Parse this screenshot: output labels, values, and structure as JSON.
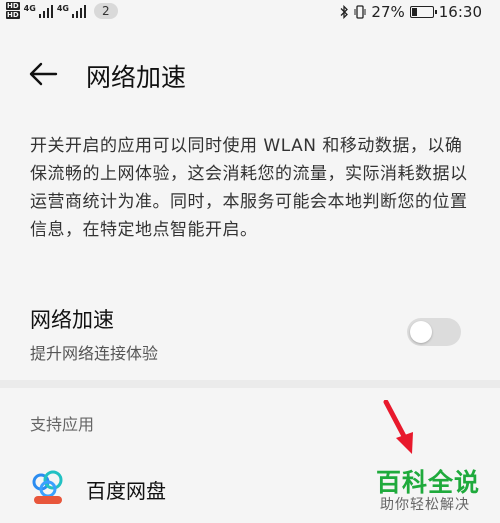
{
  "status_bar": {
    "hd_top": "HD",
    "hd_bottom": "HD",
    "signal1_label": "4G",
    "signal2_label": "4G",
    "notification_count": "2",
    "battery_percent": "27%",
    "battery_level": 0.27,
    "time": "16:30",
    "icons": [
      "bluetooth-icon",
      "vibrate-icon",
      "battery-icon",
      "signal-icon"
    ]
  },
  "header": {
    "title": "网络加速",
    "back_icon": "arrow-left-icon"
  },
  "description": "开关开启的应用可以同时使用 WLAN 和移动数据，以确保流畅的上网体验，这会消耗您的流量，实际消耗数据以运营商统计为准。同时，本服务可能会本地判断您的位置信息，在特定地点智能开启。",
  "setting": {
    "title": "网络加速",
    "subtitle": "提升网络连接体验",
    "toggle_on": false
  },
  "section": {
    "label": "支持应用"
  },
  "apps": [
    {
      "name": "百度网盘",
      "icon": "baidu-netdisk-icon"
    }
  ],
  "watermark": {
    "main": "百科全说",
    "sub": "助你轻松解决"
  },
  "colors": {
    "background": "#f5f5f5",
    "toggle_off": "#dcdcdc",
    "annotation_red": "#e8192c",
    "watermark_green": "#1faa3c"
  }
}
